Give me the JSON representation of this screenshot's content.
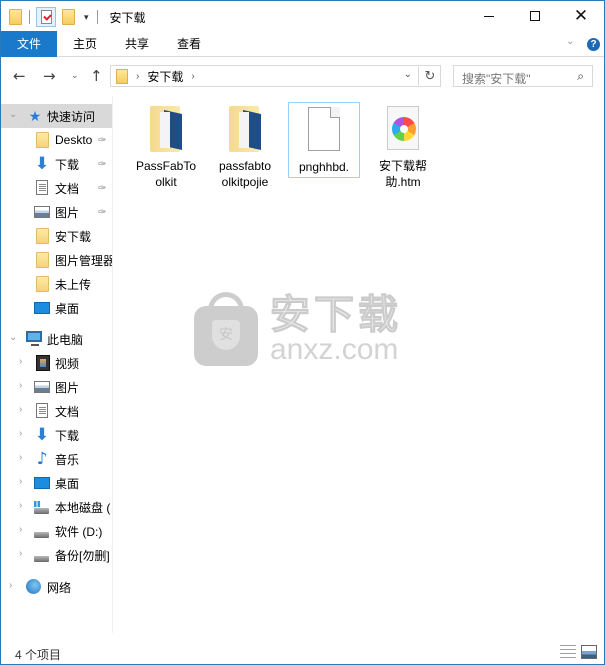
{
  "window": {
    "title": "安下载",
    "minimize_label": "Minimize",
    "maximize_label": "Maximize",
    "close_label": "Close"
  },
  "quick_access_toolbar": {
    "items": [
      "folder-icon",
      "properties-icon",
      "new-folder-icon"
    ],
    "dropdown_glyph": "▾"
  },
  "ribbon": {
    "tabs": [
      {
        "label": "文件",
        "active": true
      },
      {
        "label": "主页"
      },
      {
        "label": "共享"
      },
      {
        "label": "查看"
      }
    ],
    "expand_glyph": "⌄",
    "help_glyph": "?"
  },
  "navigation": {
    "back_glyph": "←",
    "forward_glyph": "→",
    "recent_glyph": "⌄",
    "up_glyph": "↑",
    "address": {
      "segments": [
        "安下载"
      ],
      "separator": "›"
    },
    "refresh_glyph": "↻",
    "search_placeholder": "搜索\"安下载\"",
    "search_glyph": "⚲"
  },
  "sidebar": {
    "quick_access": {
      "label": "快速访问",
      "items": [
        {
          "label": "Deskto",
          "icon": "folder",
          "pinned": true
        },
        {
          "label": "下载",
          "icon": "download",
          "pinned": true
        },
        {
          "label": "文档",
          "icon": "document",
          "pinned": true
        },
        {
          "label": "图片",
          "icon": "picture",
          "pinned": true
        },
        {
          "label": "安下载",
          "icon": "folder",
          "pinned": false
        },
        {
          "label": "图片管理器",
          "icon": "folder",
          "pinned": false
        },
        {
          "label": "未上传",
          "icon": "folder",
          "pinned": false
        },
        {
          "label": "桌面",
          "icon": "desktop",
          "pinned": false
        }
      ]
    },
    "this_pc": {
      "label": "此电脑",
      "items": [
        {
          "label": "视频",
          "icon": "video"
        },
        {
          "label": "图片",
          "icon": "picture"
        },
        {
          "label": "文档",
          "icon": "document"
        },
        {
          "label": "下载",
          "icon": "download"
        },
        {
          "label": "音乐",
          "icon": "music"
        },
        {
          "label": "桌面",
          "icon": "desktop"
        },
        {
          "label": "本地磁盘 (",
          "icon": "system-drive"
        },
        {
          "label": "软件 (D:)",
          "icon": "drive"
        },
        {
          "label": "备份[勿删]",
          "icon": "drive"
        }
      ]
    },
    "network": {
      "label": "网络"
    },
    "pin_glyph": "✑",
    "chevron_expanded": "⌄",
    "chevron_collapsed": "›"
  },
  "files": [
    {
      "name": "PassFabToolkit",
      "line1": "PassFabTo",
      "line2": "olkit",
      "type": "folder"
    },
    {
      "name": "passfabtoolkitpojie",
      "line1": "passfabto",
      "line2": "olkitpojie",
      "type": "folder"
    },
    {
      "name": "pnghhbd.",
      "line1": "pnghhbd.",
      "line2": "",
      "type": "file",
      "selected": true
    },
    {
      "name": "安下载帮助.htm",
      "line1": "安下载帮",
      "line2": "助.htm",
      "type": "htm"
    }
  ],
  "watermark": {
    "cn_text": "安下载",
    "en_text": "anxz.com",
    "badge_text": "安"
  },
  "status": {
    "item_count": "4 个项目"
  },
  "colors": {
    "accent": "#1979ca",
    "border": "#2b79b5",
    "selected_tree": "#d9d9d9",
    "selection_border": "#99d1ff"
  }
}
